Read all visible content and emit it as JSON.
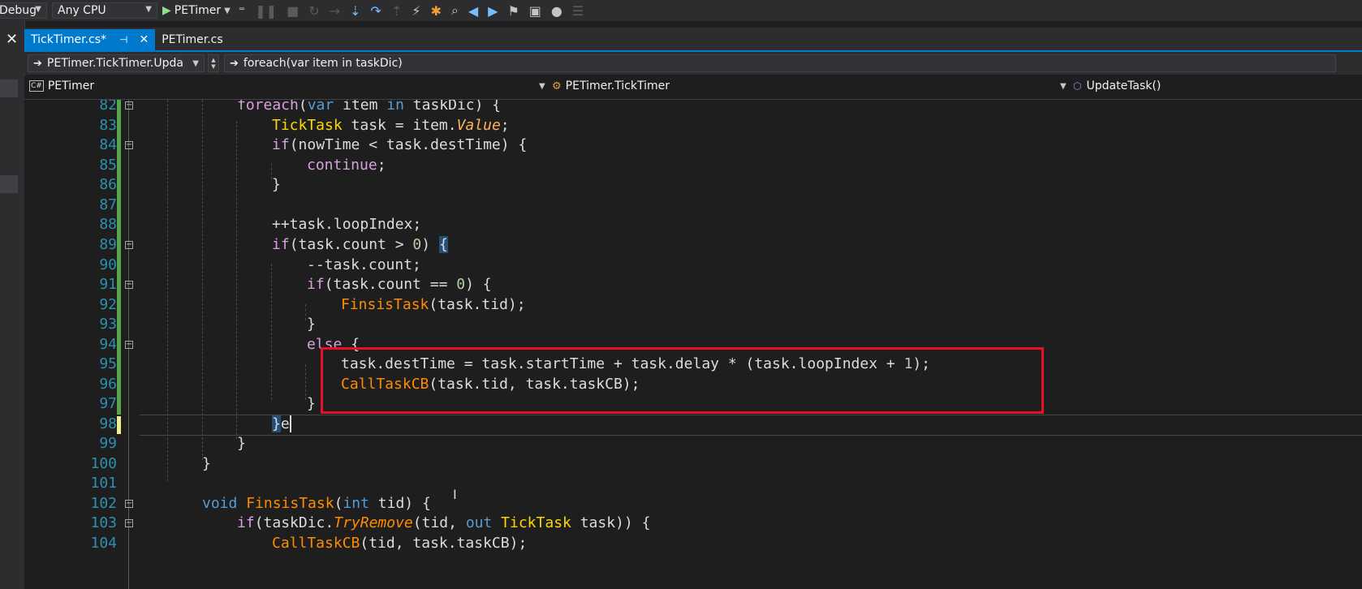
{
  "toolbar": {
    "config": "Debug",
    "platform": "Any CPU",
    "run_target": "PETimer"
  },
  "tabs": [
    {
      "label": "TickTimer.cs*",
      "active": true
    },
    {
      "label": "PETimer.cs",
      "active": false
    }
  ],
  "navbar": {
    "member": "PETimer.TickTimer.Upda",
    "statement": "foreach(var item in taskDic)"
  },
  "scope": {
    "project": "PETimer",
    "class": "PETimer.TickTimer",
    "method": "UpdateTask()"
  },
  "code_lines": [
    {
      "n": "82"
    },
    {
      "n": "83"
    },
    {
      "n": "84"
    },
    {
      "n": "85"
    },
    {
      "n": "86"
    },
    {
      "n": "87"
    },
    {
      "n": "88"
    },
    {
      "n": "89"
    },
    {
      "n": "90"
    },
    {
      "n": "91"
    },
    {
      "n": "92"
    },
    {
      "n": "93"
    },
    {
      "n": "94"
    },
    {
      "n": "95"
    },
    {
      "n": "96"
    },
    {
      "n": "97"
    },
    {
      "n": "98"
    },
    {
      "n": "99"
    },
    {
      "n": "100"
    },
    {
      "n": "101"
    },
    {
      "n": "102"
    },
    {
      "n": "103"
    },
    {
      "n": "104"
    }
  ],
  "colors": {
    "accent": "#007acc",
    "highlight_box": "#e81123",
    "change_bar": "#57a64a"
  }
}
